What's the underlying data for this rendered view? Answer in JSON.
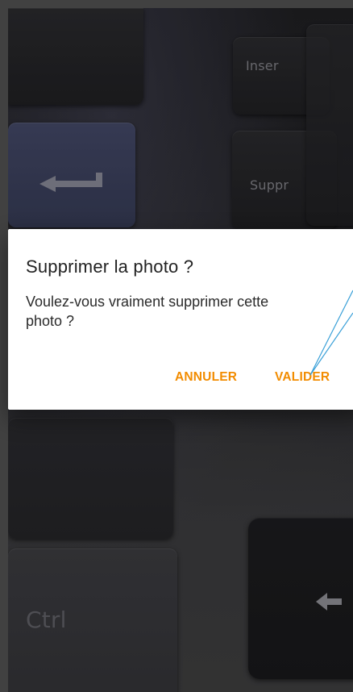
{
  "background": {
    "keys": {
      "inser": "Inser",
      "suppr": "Suppr",
      "ctrl": "Ctrl"
    }
  },
  "dialog": {
    "title": "Supprimer la photo ?",
    "message": "Voulez-vous vraiment supprimer cette photo ?",
    "cancel_label": "ANNULER",
    "confirm_label": "VALIDER"
  },
  "colors": {
    "accent": "#f28c00",
    "pointer": "#3aa0d8"
  },
  "icons": {
    "enter": "enter-arrow-icon",
    "left": "left-arrow-icon"
  }
}
